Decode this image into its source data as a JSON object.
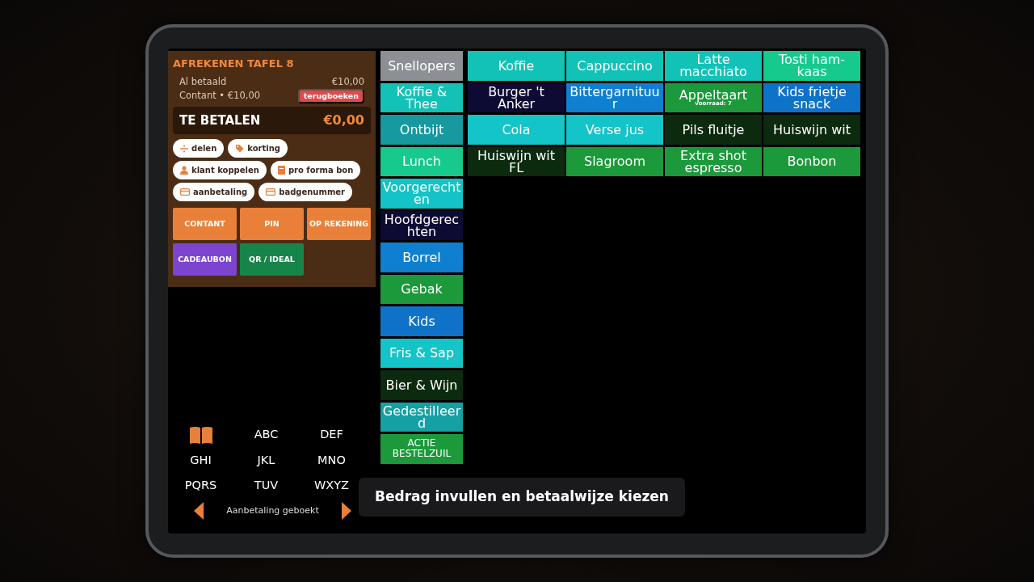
{
  "payment": {
    "title": "AFREKENEN TAFEL 8",
    "paid_label": "Al betaald",
    "paid_amount": "€10,00",
    "payment_line": "Contant • €10,00",
    "undo": "terugboeken",
    "due_label": "TE BETALEN",
    "due_amount": "€0,00"
  },
  "actions": [
    {
      "label": "delen",
      "kind": "divide"
    },
    {
      "label": "korting",
      "kind": "tag"
    },
    {
      "label": "klant koppelen",
      "kind": "person"
    },
    {
      "label": "pro forma bon",
      "kind": "receipt"
    },
    {
      "label": "aanbetaling",
      "kind": "card"
    },
    {
      "label": "badgenummer",
      "kind": "card"
    }
  ],
  "methods": [
    {
      "label": "CONTANT",
      "color": "#e8803a"
    },
    {
      "label": "PIN",
      "color": "#e8803a"
    },
    {
      "label": "OP REKENING",
      "color": "#e8803a"
    },
    {
      "label": "CADEAUBON",
      "color": "#7b45cf"
    },
    {
      "label": "QR / IDEAL",
      "color": "#17854a"
    }
  ],
  "keypad": [
    {
      "kind": "icon"
    },
    {
      "kind": "text",
      "label": "ABC"
    },
    {
      "kind": "text",
      "label": "DEF"
    },
    {
      "kind": "text",
      "label": "GHI"
    },
    {
      "kind": "text",
      "label": "JKL"
    },
    {
      "kind": "text",
      "label": "MNO"
    },
    {
      "kind": "text",
      "label": "PQRS"
    },
    {
      "kind": "text",
      "label": "TUV"
    },
    {
      "kind": "text",
      "label": "WXYZ"
    }
  ],
  "pager": {
    "message": "Aanbetaling geboekt"
  },
  "categories": [
    {
      "label": "Snellopers",
      "color": "#8c8f93",
      "kind": "normal"
    },
    {
      "label": "Koffie & Thee",
      "color": "#13c2b6",
      "kind": "normal"
    },
    {
      "label": "Ontbijt",
      "color": "#16999f",
      "kind": "normal"
    },
    {
      "label": "Lunch",
      "color": "#16c98c",
      "kind": "normal"
    },
    {
      "label": "Voorgerechten",
      "color": "#13c3c6",
      "kind": "normal"
    },
    {
      "label": "Hoofdgerechten",
      "color": "#0d0b33",
      "kind": "normal"
    },
    {
      "label": "Borrel",
      "color": "#0f7fcf",
      "kind": "normal"
    },
    {
      "label": "Gebak",
      "color": "#1c993a",
      "kind": "normal"
    },
    {
      "label": "Kids",
      "color": "#0f72c9",
      "kind": "normal"
    },
    {
      "label": "Fris & Sap",
      "color": "#13c4c8",
      "kind": "normal"
    },
    {
      "label": "Bier & Wijn",
      "color": "#0c2a0e",
      "kind": "normal"
    },
    {
      "label": "Gedestilleerd",
      "color": "#15a0a4",
      "kind": "normal"
    },
    {
      "label": "ACTIE BESTELZUIL",
      "color": "#1c993a",
      "kind": "small"
    }
  ],
  "products": [
    {
      "label": "Koffie",
      "color": "#13c2b6"
    },
    {
      "label": "Cappuccino",
      "color": "#13c2b6"
    },
    {
      "label": "Latte macchiato",
      "color": "#13c2b6"
    },
    {
      "label": "Tosti ham-kaas",
      "color": "#16c98c"
    },
    {
      "label": "Burger 't Anker",
      "color": "#0d0b33"
    },
    {
      "label": "Bittergarnituur",
      "color": "#0f7fcf"
    },
    {
      "label": "Appeltaart",
      "color": "#1c993a",
      "stock": "voorraad: 7"
    },
    {
      "label": "Kids frietje snack",
      "color": "#0f72c9"
    },
    {
      "label": "Cola",
      "color": "#13c4c8"
    },
    {
      "label": "Verse jus",
      "color": "#13c4c8"
    },
    {
      "label": "Pils fluitje",
      "color": "#0c2a0e"
    },
    {
      "label": "Huiswijn wit",
      "color": "#0c2a0e"
    },
    {
      "label": "Huiswijn wit FL",
      "color": "#0c2a0e"
    },
    {
      "label": "Slagroom",
      "color": "#1c993a"
    },
    {
      "label": "Extra shot espresso",
      "color": "#1c993a"
    },
    {
      "label": "Bonbon",
      "color": "#1c993a"
    }
  ],
  "tooltip": "Bedrag invullen en betaalwijze kiezen"
}
